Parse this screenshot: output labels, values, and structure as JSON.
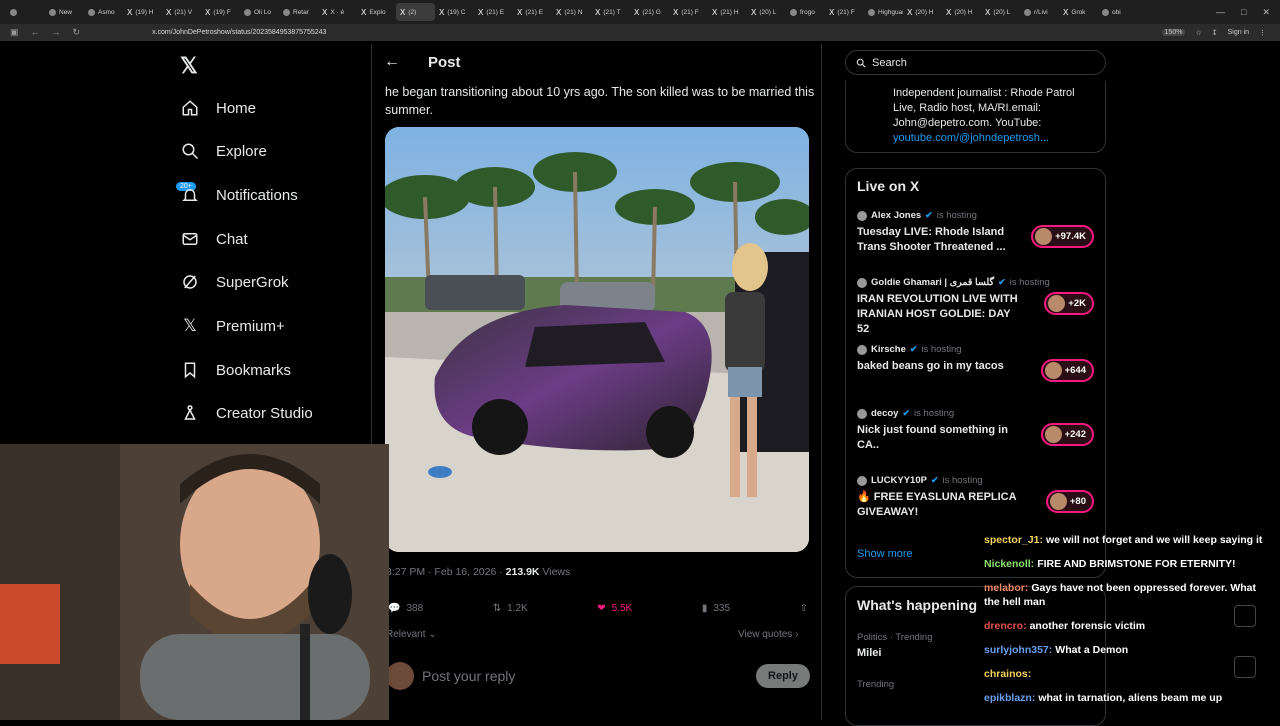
{
  "browser": {
    "tabs": [
      {
        "label": "",
        "icon": "arrow-icon"
      },
      {
        "label": "New",
        "icon": "page-icon"
      },
      {
        "label": "Asmo",
        "icon": "page-icon"
      },
      {
        "label": "(19) H",
        "icon": "x-icon"
      },
      {
        "label": "(21) V",
        "icon": "x-icon"
      },
      {
        "label": "(19) F",
        "icon": "x-icon"
      },
      {
        "label": "Oli Lo",
        "icon": "page-icon"
      },
      {
        "label": "Retar",
        "icon": "page-icon"
      },
      {
        "label": "X · é",
        "icon": "x-icon"
      },
      {
        "label": "Explo",
        "icon": "x-icon"
      },
      {
        "label": "(2)",
        "icon": "x-icon",
        "active": true
      },
      {
        "label": "(19) C",
        "icon": "x-icon"
      },
      {
        "label": "(21) E",
        "icon": "x-icon"
      },
      {
        "label": "(21) E",
        "icon": "x-icon"
      },
      {
        "label": "(21) N",
        "icon": "x-icon"
      },
      {
        "label": "(21) T",
        "icon": "x-icon"
      },
      {
        "label": "(21) G",
        "icon": "x-icon"
      },
      {
        "label": "(21) F",
        "icon": "x-icon"
      },
      {
        "label": "(21) H",
        "icon": "x-icon"
      },
      {
        "label": "(20) L",
        "icon": "x-icon"
      },
      {
        "label": "frogo",
        "icon": "page-icon"
      },
      {
        "label": "(21) F",
        "icon": "x-icon"
      },
      {
        "label": "Highguar",
        "icon": "page-icon"
      },
      {
        "label": "(20) H",
        "icon": "x-icon"
      },
      {
        "label": "(20) H",
        "icon": "x-icon"
      },
      {
        "label": "(20) L",
        "icon": "x-icon"
      },
      {
        "label": "r/Livi",
        "icon": "page-icon"
      },
      {
        "label": "Grok",
        "icon": "x-icon"
      },
      {
        "label": "obi",
        "icon": "page-icon"
      }
    ],
    "url": "x.com/JohnDePetroshow/status/2023584953875755243",
    "zoom": "150%",
    "sign_in": "Sign in"
  },
  "nav": {
    "items": [
      {
        "label": "Home",
        "icon": "home-icon"
      },
      {
        "label": "Explore",
        "icon": "search-icon"
      },
      {
        "label": "Notifications",
        "icon": "bell-icon",
        "badge": "20+"
      },
      {
        "label": "Chat",
        "icon": "mail-icon"
      },
      {
        "label": "SuperGrok",
        "icon": "grok-icon"
      },
      {
        "label": "Premium+",
        "icon": "x-logo-icon"
      },
      {
        "label": "Bookmarks",
        "icon": "bookmark-icon"
      },
      {
        "label": "Creator Studio",
        "icon": "creator-icon"
      }
    ]
  },
  "post": {
    "header": "Post",
    "text": "he began transitioning about 10 yrs ago. The son killed was to be married this summer.",
    "time": "3:27 PM · Feb 16, 2026 ·",
    "views": "213.9K",
    "views_label": "Views",
    "replies": "388",
    "reposts": "1.2K",
    "likes": "5.5K",
    "bookmarks": "335",
    "sort": "Relevant",
    "view_quotes": "View quotes",
    "reply_placeholder": "Post your reply",
    "reply_button": "Reply"
  },
  "right": {
    "search_placeholder": "Search",
    "bio": "Independent journalist : Rhode Patrol Live, Radio host, MA/RI.email: John@depetro.com. YouTube:",
    "bio_link": "youtube.com/@johndepetrosh...",
    "live_title": "Live on X",
    "live": [
      {
        "host": "Alex Jones",
        "hosting": "is hosting",
        "title": "Tuesday LIVE: Rhode Island Trans Shooter Threatened ...",
        "count": "+97.4K"
      },
      {
        "host": "Goldie Ghamari | گلسا قمری",
        "hosting": "is hosting",
        "title": "IRAN REVOLUTION LIVE WITH IRANIAN HOST GOLDIE: DAY 52",
        "count": "+2K"
      },
      {
        "host": "Kirsche",
        "hosting": "is hosting",
        "title": "baked beans go in my tacos",
        "count": "+644"
      },
      {
        "host": "decoy",
        "hosting": "is hosting",
        "title": "Nick just found something in CA..",
        "count": "+242"
      },
      {
        "host": "LUCKYY10P",
        "hosting": "is hosting",
        "title": "🔥 FREE EYASLUNA REPLICA GIVEAWAY!",
        "count": "+80"
      }
    ],
    "show_more": "Show more",
    "trends_title": "What's happening",
    "trends": [
      {
        "category": "Politics · Trending",
        "name": "Milei"
      },
      {
        "category": "Trending",
        "name": ""
      }
    ]
  },
  "chat": [
    {
      "user": "spector_J1:",
      "color": "#f5d35c",
      "msg": "we will not forget and we will keep saying it"
    },
    {
      "user": "Nickenoll:",
      "color": "#8be56b",
      "msg": "FIRE AND BRIMSTONE FOR ETERNITY!"
    },
    {
      "user": "melabor:",
      "color": "#f08a6a",
      "msg": "Gays have not been oppressed forever. What the hell man"
    },
    {
      "user": "drencro:",
      "color": "#e05050",
      "msg": "another forensic victim"
    },
    {
      "user": "surlyjohn357:",
      "color": "#6aa0f0",
      "msg": "What a Demon"
    },
    {
      "user": "chrainos:",
      "color": "#f5d35c",
      "msg": ""
    },
    {
      "user": "epikblazn:",
      "color": "#6aa0f0",
      "msg": "what in tarnation, aliens beam me up"
    }
  ]
}
